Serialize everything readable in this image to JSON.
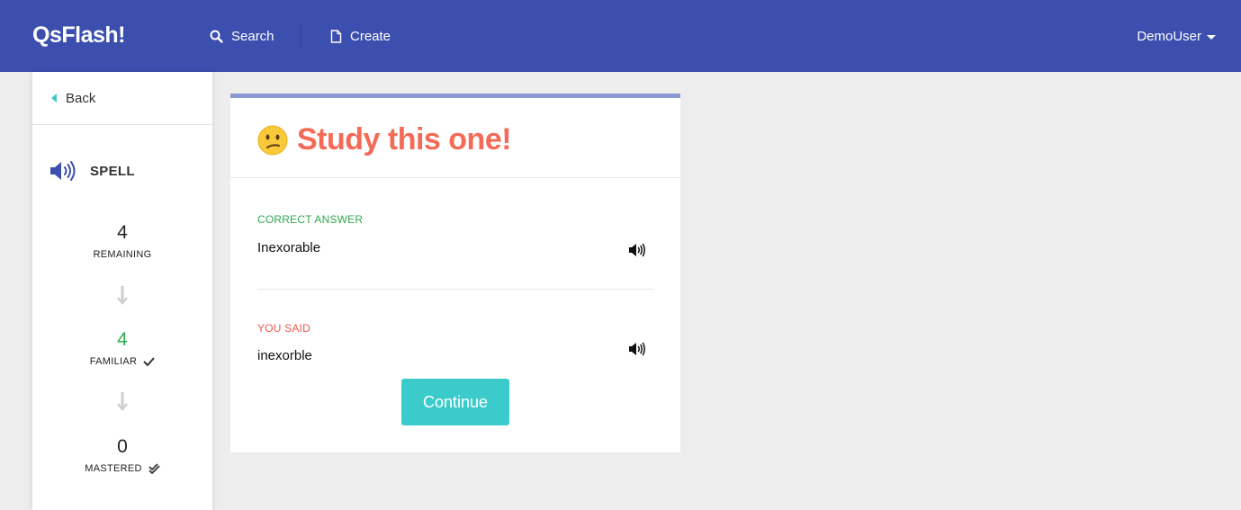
{
  "nav": {
    "brand": "QsFlash!",
    "search_label": "Search",
    "create_label": "Create",
    "user_label": "DemoUser",
    "bg_color": "#3c4fae"
  },
  "sidebar": {
    "back_label": "Back",
    "mode_label": "SPELL",
    "stats": [
      {
        "value": "4",
        "label": "REMAINING"
      },
      {
        "value": "4",
        "label": "FAMILIAR"
      },
      {
        "value": "0",
        "label": "MASTERED"
      }
    ]
  },
  "card": {
    "title": "Study this one!",
    "emoji": "😕",
    "correct_heading": "CORRECT ANSWER",
    "correct_answer": "Inexorable",
    "said_heading": "YOU SAID",
    "said_answer": "inexorble",
    "continue_label": "Continue",
    "title_color": "#f56a57",
    "button_color": "#3ccbcb"
  }
}
